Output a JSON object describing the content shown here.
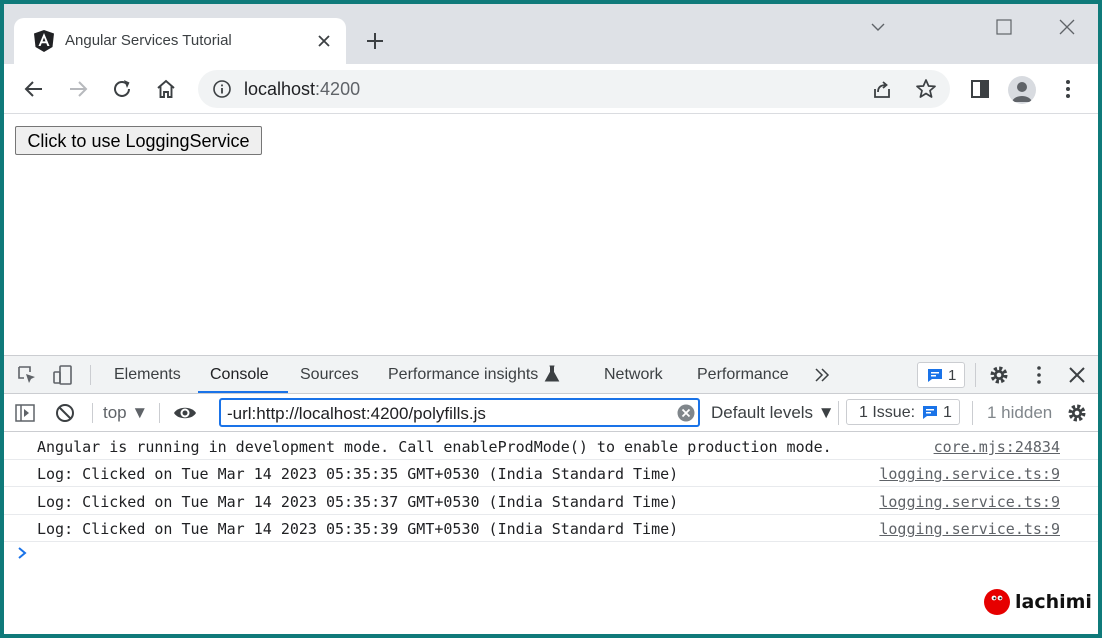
{
  "browser": {
    "tab": {
      "title": "Angular Services Tutorial",
      "favicon": "angular-logo-icon"
    },
    "address": {
      "host": "localhost",
      "port": ":4200"
    }
  },
  "page": {
    "button_label": "Click to use LoggingService"
  },
  "devtools": {
    "tabs": [
      {
        "label": "Elements"
      },
      {
        "label": "Console"
      },
      {
        "label": "Sources"
      },
      {
        "label": "Performance insights"
      },
      {
        "label": "Network"
      },
      {
        "label": "Performance"
      }
    ],
    "active_tab": "Console",
    "messages_badge": "1",
    "context": "top",
    "filter_value": "-url:http://localhost:4200/polyfills.js",
    "levels_label": "Default levels",
    "issues_label": "1 Issue:",
    "issues_count": "1",
    "hidden_label": "1 hidden",
    "accent_color": "#1a73e8",
    "logs": [
      {
        "message": "Angular is running in development mode. Call enableProdMode() to enable production mode.",
        "source": "core.mjs:24834"
      },
      {
        "message": "Log: Clicked on Tue Mar 14 2023 05:35:35 GMT+0530 (India Standard Time)",
        "source": "logging.service.ts:9"
      },
      {
        "message": "Log: Clicked on Tue Mar 14 2023 05:35:37 GMT+0530 (India Standard Time)",
        "source": "logging.service.ts:9"
      },
      {
        "message": "Log: Clicked on Tue Mar 14 2023 05:35:39 GMT+0530 (India Standard Time)",
        "source": "logging.service.ts:9"
      }
    ]
  },
  "branding": {
    "text": "lachimi",
    "color": "#e60000"
  }
}
